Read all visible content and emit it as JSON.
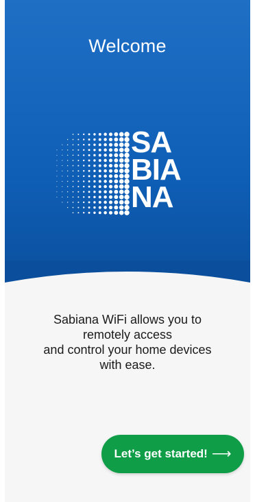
{
  "header": {
    "title": "Welcome"
  },
  "logo": {
    "lines": [
      "SA",
      "BI",
      "A",
      "NA"
    ],
    "icon": "sabiana-dot-grid-logo"
  },
  "description": {
    "lines": [
      "Sabiana WiFi allows  you to",
      "remotely access",
      "and control your home devices",
      "with ease."
    ]
  },
  "cta": {
    "label": "Let’s get started!",
    "icon": "arrow-right-icon",
    "arrow": "⟶"
  },
  "colors": {
    "hero": "#0f5fb7",
    "background": "#f6f6f6",
    "button": "#0f9e47",
    "text": "#1a1a1a"
  }
}
